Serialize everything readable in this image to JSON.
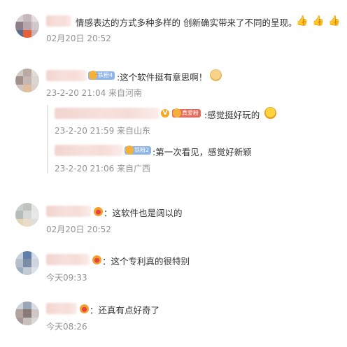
{
  "comments": [
    {
      "text": "情感表达的方式多种多样的 创新确实带来了不同的呈现。",
      "meta": "02月20日 20:52",
      "reactions": [
        "thumbs-up",
        "thumbs-up",
        "thumbs-up"
      ]
    },
    {
      "badge": "铁粉4",
      "text": ":这个软件挺有意思啊！",
      "meta": "23-2-20 21:04 来自河南",
      "replies": [
        {
          "badge": "真爱粉",
          "text": ":感觉挺好玩的",
          "meta": "23-2-20 21:59 来自山东"
        },
        {
          "badge": "铁粉2",
          "text": ":第一次看见，感觉好新颖",
          "meta": "23-2-20 21:06 来自广西"
        }
      ]
    },
    {
      "text": "：这软件也是阔以的",
      "meta": "02月20日 20:52"
    },
    {
      "text": "：这个专利真的很特别",
      "meta": "今天09:33"
    },
    {
      "text": "：还真有点好奇了",
      "meta": "今天08:26"
    }
  ],
  "colors": {
    "text": "#333333",
    "meta": "#939393",
    "badge_blue": "#8fb5e8",
    "badge_red": "#e86a5a"
  }
}
